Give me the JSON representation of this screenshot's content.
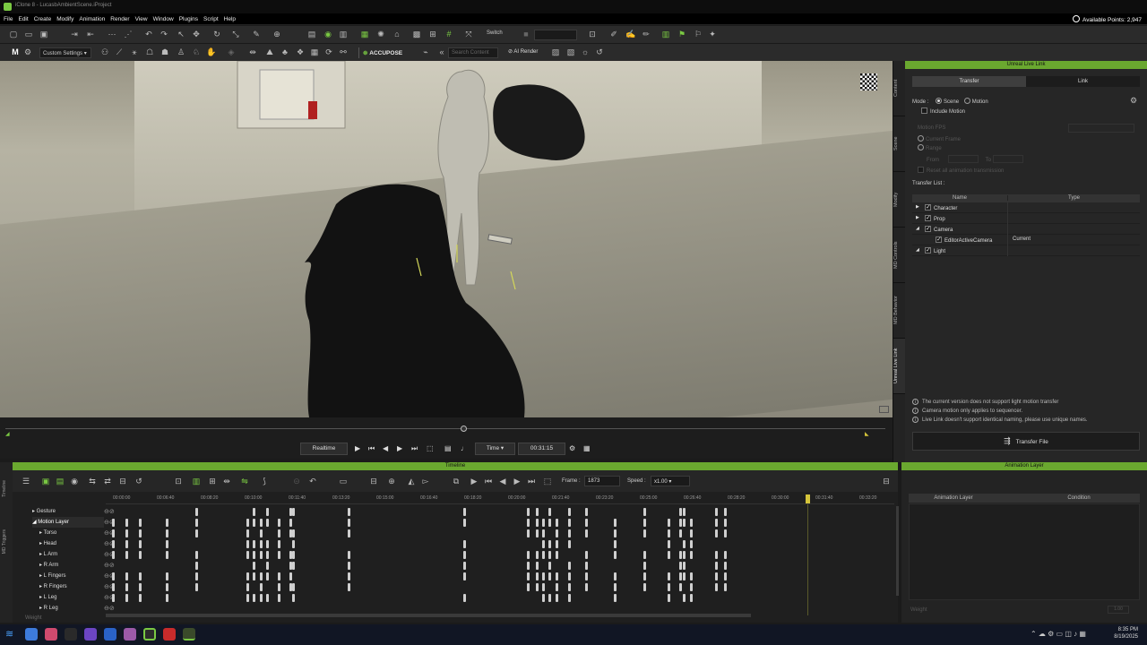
{
  "window": {
    "title": "iClone 8 - LucasbAmbientScene.iProject"
  },
  "menu": [
    "File",
    "Edit",
    "Create",
    "Modify",
    "Animation",
    "Render",
    "View",
    "Window",
    "Plugins",
    "Script",
    "Help"
  ],
  "points": "Available Points: 2,947",
  "toolbar2": {
    "settings": "Custom Settings",
    "accupose_prefix": "ACCU",
    "accupose_suffix": "POSE",
    "search_placeholder": "Search Content",
    "ai_render": "AI Render",
    "switch": "Switch"
  },
  "playback": {
    "mode": "Realtime",
    "time_mode": "Time",
    "timecode": "00:31:15"
  },
  "right_tabs": [
    "Content",
    "Scene",
    "Modify",
    "MD Controls",
    "MD Behavior",
    "Unreal Live Link"
  ],
  "unreal": {
    "title": "Unreal Live Link",
    "tabs": [
      "Transfer",
      "Link"
    ],
    "mode_label": "Mode :",
    "mode_options": [
      "Scene",
      "Motion"
    ],
    "include_motion": "Include Motion",
    "motion_fps": "Motion FPS",
    "current_frame": "Current Frame",
    "range": "Range",
    "from": "From",
    "to": "To",
    "reset_all": "Reset all animation transmission",
    "transfer_list": "Transfer List :",
    "cols": [
      "Name",
      "Type"
    ],
    "rows": [
      {
        "name": "Character",
        "type": ""
      },
      {
        "name": "Prop",
        "type": ""
      },
      {
        "name": "Camera",
        "type": ""
      },
      {
        "name": "EditorActiveCamera",
        "type": "Current"
      },
      {
        "name": "Light",
        "type": ""
      }
    ],
    "notes": [
      "The current version does not support light motion transfer",
      "Camera motion only applies to sequencer.",
      "Live Link doesn't support identical naming, please use unique names."
    ],
    "transfer_file": "Transfer File"
  },
  "timeline": {
    "title": "Timeline",
    "frame_label": "Frame :",
    "frame": "1873",
    "speed_label": "Speed :",
    "speed": "x1.00",
    "ticks": [
      "00:00:00",
      "00:06:40",
      "00:08:20",
      "00:10:00",
      "00:11:40",
      "00:13:20",
      "00:15:00",
      "00:16:40",
      "00:18:20",
      "00:20:00",
      "00:21:40",
      "00:23:20",
      "00:25:00",
      "00:26:40",
      "00:28:20",
      "00:30:00",
      "00:31:40",
      "00:33:20"
    ],
    "tracks": [
      "Gesture",
      "Motion Layer",
      "Torso",
      "Head",
      "L Arm",
      "R Arm",
      "L Fingers",
      "R Fingers",
      "L Leg",
      "R Leg",
      "Weight"
    ],
    "side_label": "MD Triggers",
    "side_label2": "Timeline"
  },
  "anim_layer": {
    "title": "Animation Layer",
    "cols": [
      "Animation Layer",
      "Condition"
    ],
    "footer": "Weight",
    "footer_val": "1.00"
  },
  "taskbar": {
    "time": "8:35 PM",
    "date": "8/19/2025"
  }
}
